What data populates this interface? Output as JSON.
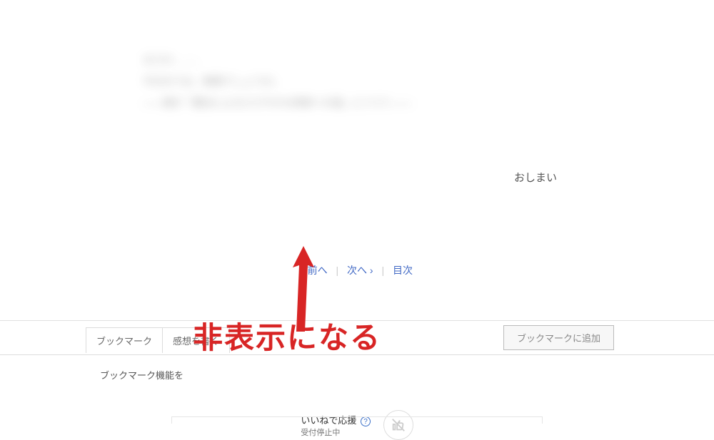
{
  "content": {
    "blurred_lines": [
      "まさか……、",
      "今日までは、無事でしょうか。",
      "――僕が「魔法によるささやかな奇跡への道」につづく――"
    ],
    "end_marker": "おしまい"
  },
  "nav": {
    "prev": "‹ 前へ",
    "next": "次へ ›",
    "toc": "目次"
  },
  "tabs": {
    "bookmark": "ブックマーク",
    "review": "感想を書く"
  },
  "buttons": {
    "add_bookmark": "ブックマークに追加"
  },
  "hint": {
    "bookmark_prefix": "ブックマーク機能を"
  },
  "iine": {
    "title": "いいねで応援",
    "status": "受付停止中"
  },
  "annotation": {
    "text": "非表示になる"
  }
}
